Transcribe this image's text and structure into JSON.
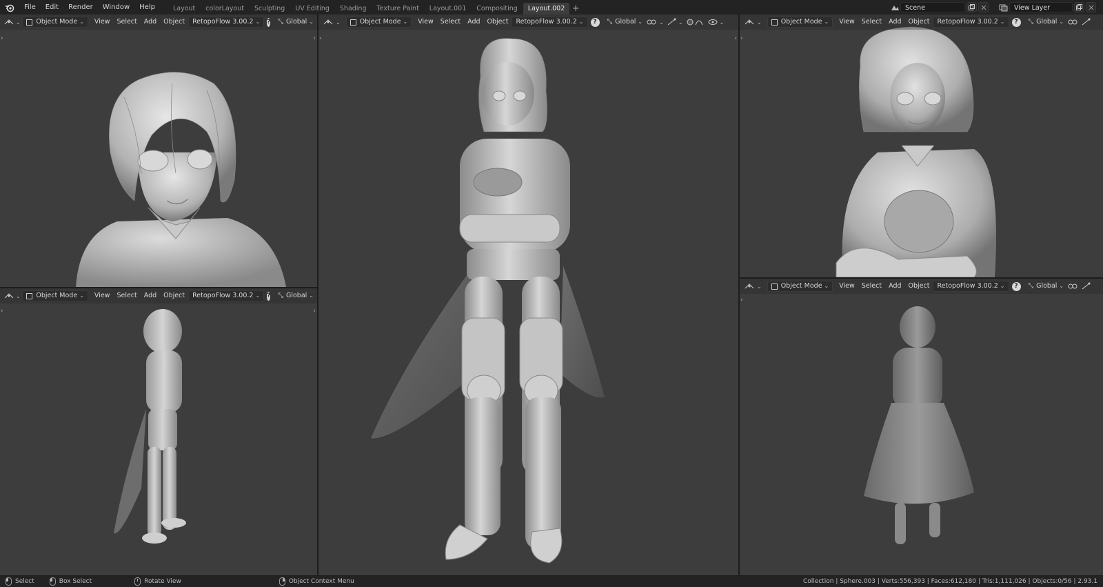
{
  "topbar": {
    "menus": [
      "File",
      "Edit",
      "Render",
      "Window",
      "Help"
    ],
    "workspaces": [
      "Layout",
      "colorLayout",
      "Sculpting",
      "UV Editing",
      "Shading",
      "Texture Paint",
      "Layout.001",
      "Compositing",
      "Layout.002"
    ],
    "active_workspace": "Layout.002",
    "scene": "Scene",
    "view_layer": "View Layer"
  },
  "viewport_header": {
    "mode": "Object Mode",
    "view": "View",
    "select": "Select",
    "add": "Add",
    "object": "Object",
    "addon": "RetopoFlow 3.00.2",
    "help": "?",
    "orientation": "Global"
  },
  "statusbar": {
    "select": "Select",
    "box_select": "Box Select",
    "rotate_view": "Rotate View",
    "context_menu": "Object Context Menu",
    "stats": "Collection | Sphere.003 | Verts:556,393 | Faces:612,180 | Tris:1,111,026 | Objects:0/56 | 2.93.1"
  },
  "colors": {
    "viewport_bg": "#3d3d3d",
    "header_bg": "#232323",
    "model": "#bdbdbd"
  }
}
